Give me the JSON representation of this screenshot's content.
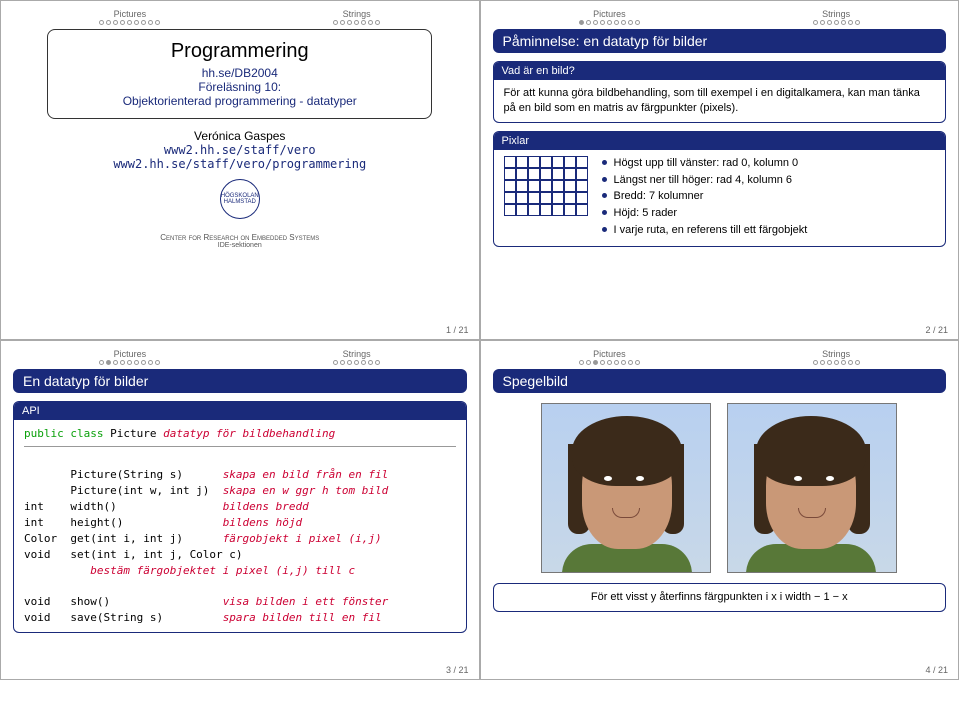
{
  "nav": {
    "pictures": "Pictures",
    "strings": "Strings"
  },
  "slide1": {
    "title": "Programmering",
    "sub1": "hh.se/DB2004",
    "sub2a": "Föreläsning 10:",
    "sub2b": "Objektorienterad programmering - datatyper",
    "author": "Verónica Gaspes",
    "url1": "www2.hh.se/staff/vero",
    "url2": "www2.hh.se/staff/vero/programmering",
    "ceres": "Center for Research on Embedded Systems",
    "ceres2": "IDE-sektionen",
    "logotext": "HÖGSKOLAN HALMSTAD",
    "pg": "1 / 21"
  },
  "slide2": {
    "title": "Påminnelse: en datatyp för bilder",
    "box1head": "Vad är en bild?",
    "box1body": "För att kunna göra bildbehandling, som till exempel i en digitalkamera, kan man tänka på en bild som en matris av färgpunkter (pixels).",
    "box2head": "Pixlar",
    "bul1": "Högst upp till vänster: rad 0, kolumn 0",
    "bul2": "Längst ner till höger: rad 4, kolumn 6",
    "bul3": "Bredd: 7 kolumner",
    "bul4": "Höjd: 5 rader",
    "bul5": "I varje ruta, en referens till ett färgobjekt",
    "pg": "2 / 21"
  },
  "slide3": {
    "title": "En datatyp för bilder",
    "boxhead": "API",
    "l1a": "public class ",
    "l1b": "Picture ",
    "l1c": "datatyp för bildbehandling",
    "r1a": "       Picture(String s)      ",
    "r1b": "skapa en bild från en fil",
    "r2a": "       Picture(int w, int j)  ",
    "r2b": "skapa en w ggr h tom bild",
    "r3a": "int    width()                ",
    "r3b": "bildens bredd",
    "r4a": "int    height()               ",
    "r4b": "bildens höjd",
    "r5a": "Color  get(int i, int j)      ",
    "r5b": "färgobjekt i pixel (i,j)",
    "r6a": "void   set(int i, int j, Color c)",
    "r6b": "          bestäm färgobjektet i pixel (i,j) till c",
    "r7a": "void   show()                 ",
    "r7b": "visa bilden i ett fönster",
    "r8a": "void   save(String s)         ",
    "r8b": "spara bilden till en fil",
    "pg": "3 / 21"
  },
  "slide4": {
    "title": "Spegelbild",
    "caption": "För ett visst y återfinns färgpunkten i x i width − 1 − x",
    "pg": "4 / 21"
  }
}
